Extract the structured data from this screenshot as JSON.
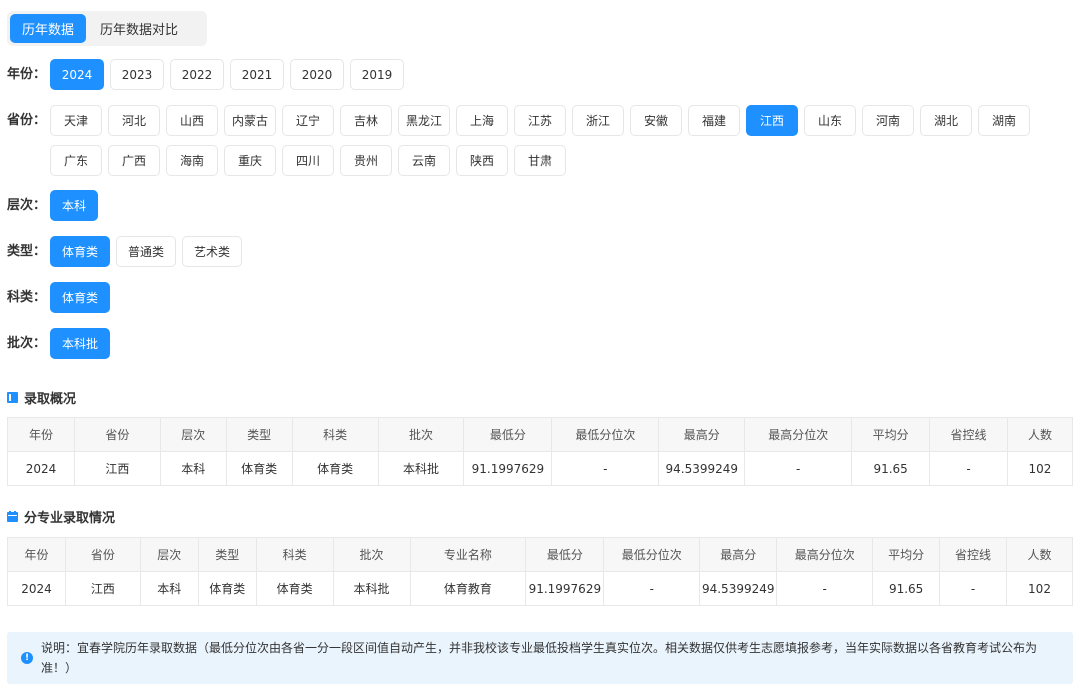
{
  "tabs": [
    "历年数据",
    "历年数据对比"
  ],
  "filters": {
    "year": {
      "label": "年份：",
      "options": [
        "2024",
        "2023",
        "2022",
        "2021",
        "2020",
        "2019"
      ]
    },
    "province": {
      "label": "省份：",
      "options": [
        "天津",
        "河北",
        "山西",
        "内蒙古",
        "辽宁",
        "吉林",
        "黑龙江",
        "上海",
        "江苏",
        "浙江",
        "安徽",
        "福建",
        "江西",
        "山东",
        "河南",
        "湖北",
        "湖南",
        "广东",
        "广西",
        "海南",
        "重庆",
        "四川",
        "贵州",
        "云南",
        "陕西",
        "甘肃"
      ]
    },
    "level": {
      "label": "层次：",
      "options": [
        "本科"
      ]
    },
    "type": {
      "label": "类型：",
      "options": [
        "体育类",
        "普通类",
        "艺术类"
      ]
    },
    "subject": {
      "label": "科类：",
      "options": [
        "体育类"
      ]
    },
    "batch": {
      "label": "批次：",
      "options": [
        "本科批"
      ]
    }
  },
  "selected": {
    "year": "2024",
    "province": "江西",
    "level": "本科",
    "type": "体育类",
    "subject": "体育类",
    "batch": "本科批"
  },
  "overview": {
    "title": "录取概况",
    "headers": [
      "年份",
      "省份",
      "层次",
      "类型",
      "科类",
      "批次",
      "最低分",
      "最低分位次",
      "最高分",
      "最高分位次",
      "平均分",
      "省控线",
      "人数"
    ],
    "rows": [
      [
        "2024",
        "江西",
        "本科",
        "体育类",
        "体育类",
        "本科批",
        "91.1997629",
        "-",
        "94.5399249",
        "-",
        "91.65",
        "-",
        "102"
      ]
    ]
  },
  "majors": {
    "title": "分专业录取情况",
    "headers": [
      "年份",
      "省份",
      "层次",
      "类型",
      "科类",
      "批次",
      "专业名称",
      "最低分",
      "最低分位次",
      "最高分",
      "最高分位次",
      "平均分",
      "省控线",
      "人数"
    ],
    "rows": [
      [
        "2024",
        "江西",
        "本科",
        "体育类",
        "体育类",
        "本科批",
        "体育教育",
        "91.1997629",
        "-",
        "94.5399249",
        "-",
        "91.65",
        "-",
        "102"
      ]
    ]
  },
  "note": {
    "icon": "info-icon",
    "text": "说明：宜春学院历年录取数据（最低分位次由各省一分一段区间值自动产生，并非我校该专业最低投档学生真实位次。相关数据仅供考生志愿填报参考，当年实际数据以各省教育考试公布为准！）"
  },
  "colors": {
    "accent": "#1e90ff",
    "note_bg": "#eaf4fd"
  }
}
